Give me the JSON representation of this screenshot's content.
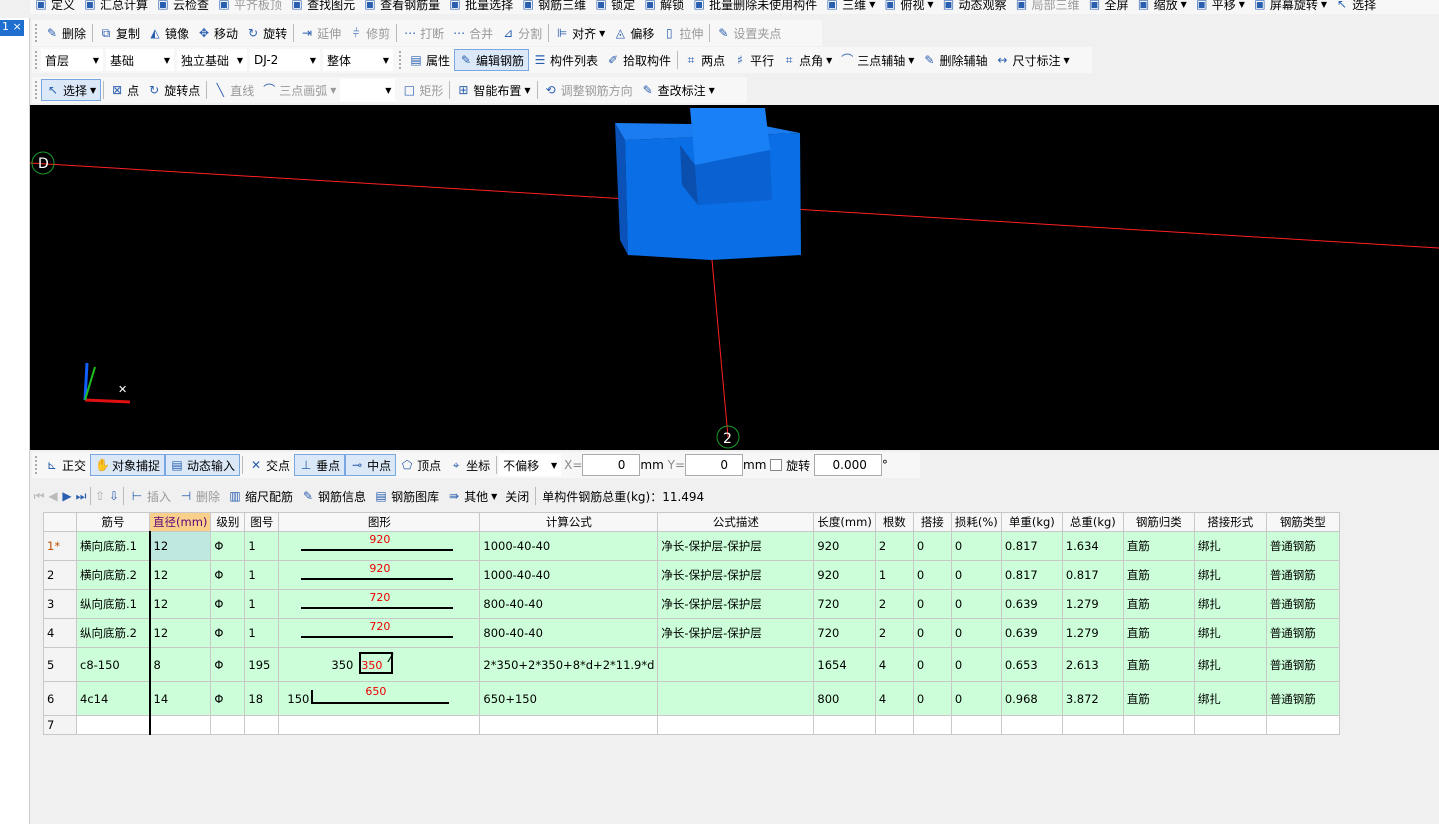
{
  "toolbar_main": [
    "定义",
    "汇总计算",
    "云检查",
    "平齐板顶",
    "查找图元",
    "查看钢筋量",
    "批量选择",
    "钢筋三维",
    "锁定",
    "解锁",
    "批量删除未使用构件",
    "三维",
    "俯视",
    "动态观察",
    "局部三维",
    "全屏",
    "缩放",
    "平移",
    "屏幕旋转",
    "选择"
  ],
  "toolbar_edit": [
    "删除",
    "复制",
    "镜像",
    "移动",
    "旋转",
    "延伸",
    "修剪",
    "打断",
    "合并",
    "分割",
    "对齐",
    "偏移",
    "拉伸",
    "设置夹点"
  ],
  "selectors": {
    "floor": "首层",
    "category": "基础",
    "type": "独立基础",
    "component": "DJ-2",
    "scope": "整体"
  },
  "toolbar_comp": [
    "属性",
    "编辑钢筋",
    "构件列表",
    "拾取构件",
    "两点",
    "平行",
    "点角",
    "三点辅轴",
    "删除辅轴",
    "尺寸标注"
  ],
  "toolbar_draw": [
    "选择",
    "点",
    "旋转点",
    "直线",
    "三点画弧",
    "",
    "矩形",
    "智能布置",
    "调整钢筋方向",
    "查改标注"
  ],
  "left_tab": "1 ×",
  "viewport": {
    "axis_labels": [
      "D",
      "2"
    ],
    "background": "#000000",
    "block_color": "#0a6ee6"
  },
  "snap": {
    "items": [
      "正交",
      "对象捕捉",
      "动态输入",
      "交点",
      "垂点",
      "中点",
      "顶点",
      "坐标"
    ],
    "offset": "不偏移",
    "x_label": "X=",
    "x": "0",
    "y_label": "Y=",
    "y": "0",
    "unit": "mm",
    "rotate_label": "旋转",
    "rotate": "0.000",
    "deg": "°"
  },
  "rebar_toolbar": {
    "items": [
      "插入",
      "删除",
      "缩尺配筋",
      "钢筋信息",
      "钢筋图库",
      "其他",
      "关闭"
    ],
    "total": "单构件钢筋总重(kg)：11.494"
  },
  "table": {
    "headers": [
      "",
      "筋号",
      "直径(mm)",
      "级别",
      "图号",
      "图形",
      "计算公式",
      "公式描述",
      "长度(mm)",
      "根数",
      "搭接",
      "损耗(%)",
      "单重(kg)",
      "总重(kg)",
      "钢筋归类",
      "搭接形式",
      "钢筋类型"
    ],
    "rows": [
      {
        "idx": "1*",
        "name": "横向底筋.1",
        "d": "12",
        "grade": "Φ",
        "fig": "1",
        "shape": "line",
        "s1": "920",
        "s2": "",
        "formula": "1000-40-40",
        "desc": "净长-保护层-保护层",
        "len": "920",
        "count": "2",
        "lap": "0",
        "loss": "0",
        "unit": "0.817",
        "total": "1.634",
        "cat": "直筋",
        "lapform": "绑扎",
        "kind": "普通钢筋"
      },
      {
        "idx": "2",
        "name": "横向底筋.2",
        "d": "12",
        "grade": "Φ",
        "fig": "1",
        "shape": "line",
        "s1": "920",
        "s2": "",
        "formula": "1000-40-40",
        "desc": "净长-保护层-保护层",
        "len": "920",
        "count": "1",
        "lap": "0",
        "loss": "0",
        "unit": "0.817",
        "total": "0.817",
        "cat": "直筋",
        "lapform": "绑扎",
        "kind": "普通钢筋"
      },
      {
        "idx": "3",
        "name": "纵向底筋.1",
        "d": "12",
        "grade": "Φ",
        "fig": "1",
        "shape": "line",
        "s1": "720",
        "s2": "",
        "formula": "800-40-40",
        "desc": "净长-保护层-保护层",
        "len": "720",
        "count": "2",
        "lap": "0",
        "loss": "0",
        "unit": "0.639",
        "total": "1.279",
        "cat": "直筋",
        "lapform": "绑扎",
        "kind": "普通钢筋"
      },
      {
        "idx": "4",
        "name": "纵向底筋.2",
        "d": "12",
        "grade": "Φ",
        "fig": "1",
        "shape": "line",
        "s1": "720",
        "s2": "",
        "formula": "800-40-40",
        "desc": "净长-保护层-保护层",
        "len": "720",
        "count": "2",
        "lap": "0",
        "loss": "0",
        "unit": "0.639",
        "total": "1.279",
        "cat": "直筋",
        "lapform": "绑扎",
        "kind": "普通钢筋"
      },
      {
        "idx": "5",
        "name": "c8-150",
        "d": "8",
        "grade": "Φ",
        "fig": "195",
        "shape": "stirrup",
        "s1": "350",
        "s2": "350",
        "formula": "2*350+2*350+8*d+2*11.9*d",
        "desc": "",
        "len": "1654",
        "count": "4",
        "lap": "0",
        "loss": "0",
        "unit": "0.653",
        "total": "2.613",
        "cat": "直筋",
        "lapform": "绑扎",
        "kind": "普通钢筋"
      },
      {
        "idx": "6",
        "name": "4c14",
        "d": "14",
        "grade": "Φ",
        "fig": "18",
        "shape": "hook",
        "s1": "650",
        "s2": "150",
        "formula": "650+150",
        "desc": "",
        "len": "800",
        "count": "4",
        "lap": "0",
        "loss": "0",
        "unit": "0.968",
        "total": "3.872",
        "cat": "直筋",
        "lapform": "绑扎",
        "kind": "普通钢筋"
      }
    ],
    "empty_idx": "7"
  }
}
